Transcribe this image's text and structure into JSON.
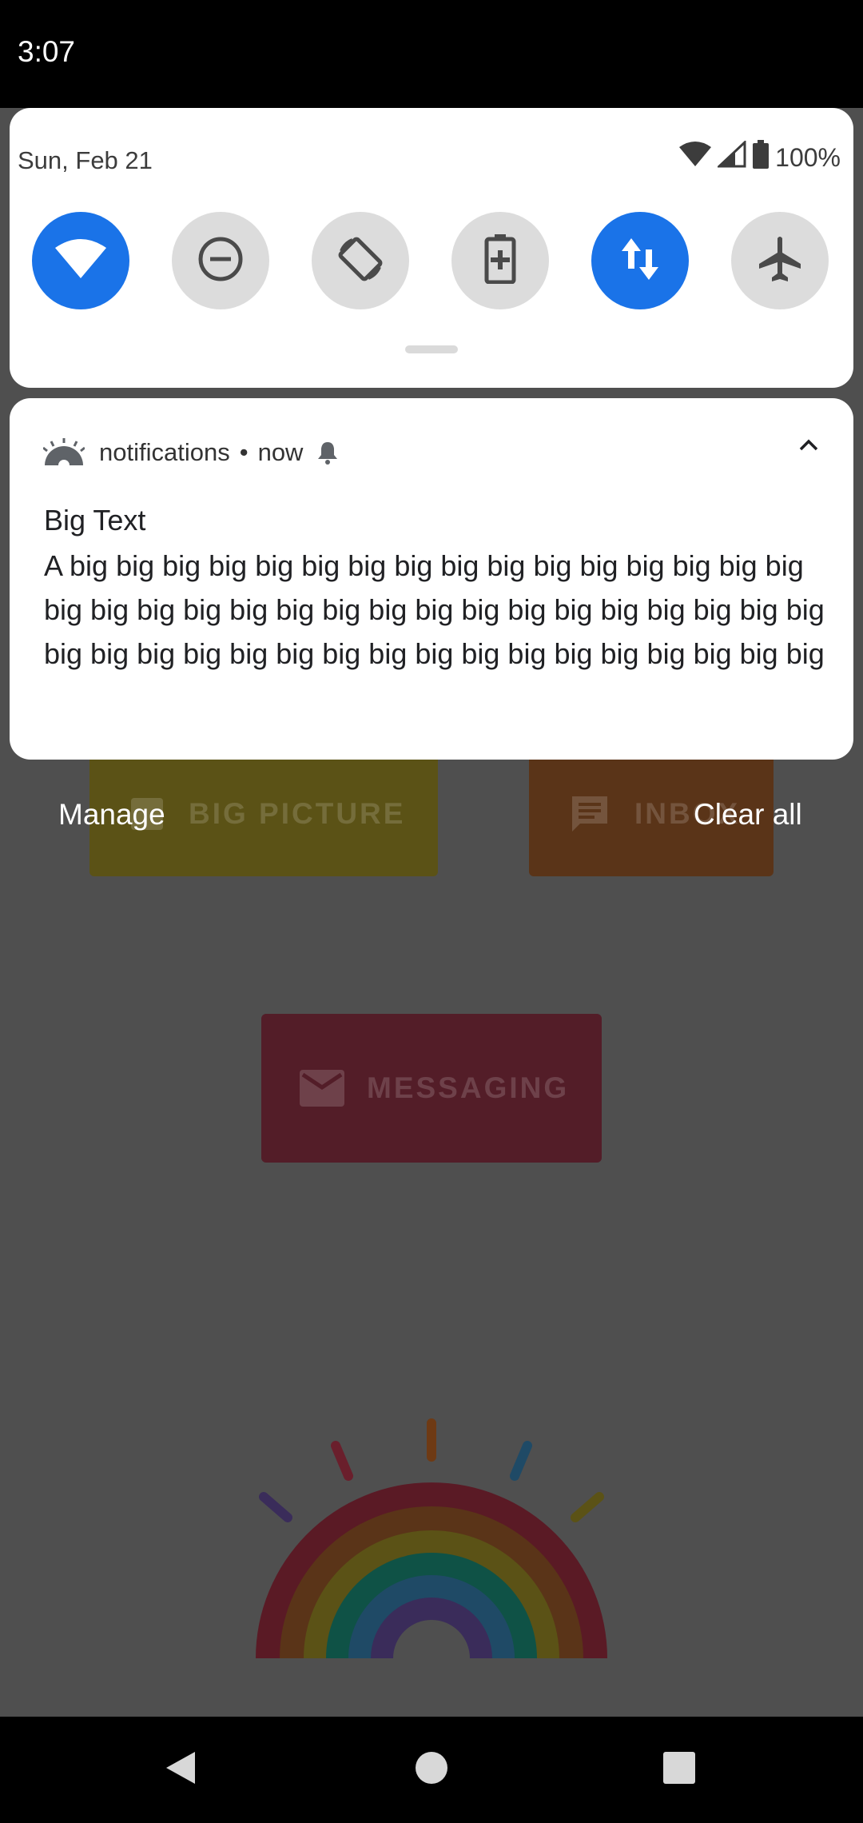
{
  "status_bar": {
    "time": "3:07"
  },
  "quick_settings": {
    "date": "Sun, Feb 21",
    "battery_percent": "100%",
    "tiles": [
      {
        "name": "wifi-icon",
        "active": true
      },
      {
        "name": "do-not-disturb-icon",
        "active": false
      },
      {
        "name": "auto-rotate-icon",
        "active": false
      },
      {
        "name": "battery-saver-icon",
        "active": false
      },
      {
        "name": "mobile-data-icon",
        "active": true
      },
      {
        "name": "airplane-mode-icon",
        "active": false
      }
    ]
  },
  "notification": {
    "app_name": "notifications",
    "separator": "•",
    "time": "now",
    "title": "Big Text",
    "body": "A big big big big big big big big big big big big big big big big big big big big big big big big big big big big big big big big big big big big big big big big big big big big big big big big big big"
  },
  "shade_actions": {
    "manage": "Manage",
    "clear_all": "Clear all"
  },
  "background_app": {
    "big_picture_label": "BIG PICTURE",
    "inbox_label": "INBOX",
    "messaging_label": "MESSAGING"
  },
  "colors": {
    "accent": "#1a73e8",
    "tile_off": "#dcdcdc"
  }
}
